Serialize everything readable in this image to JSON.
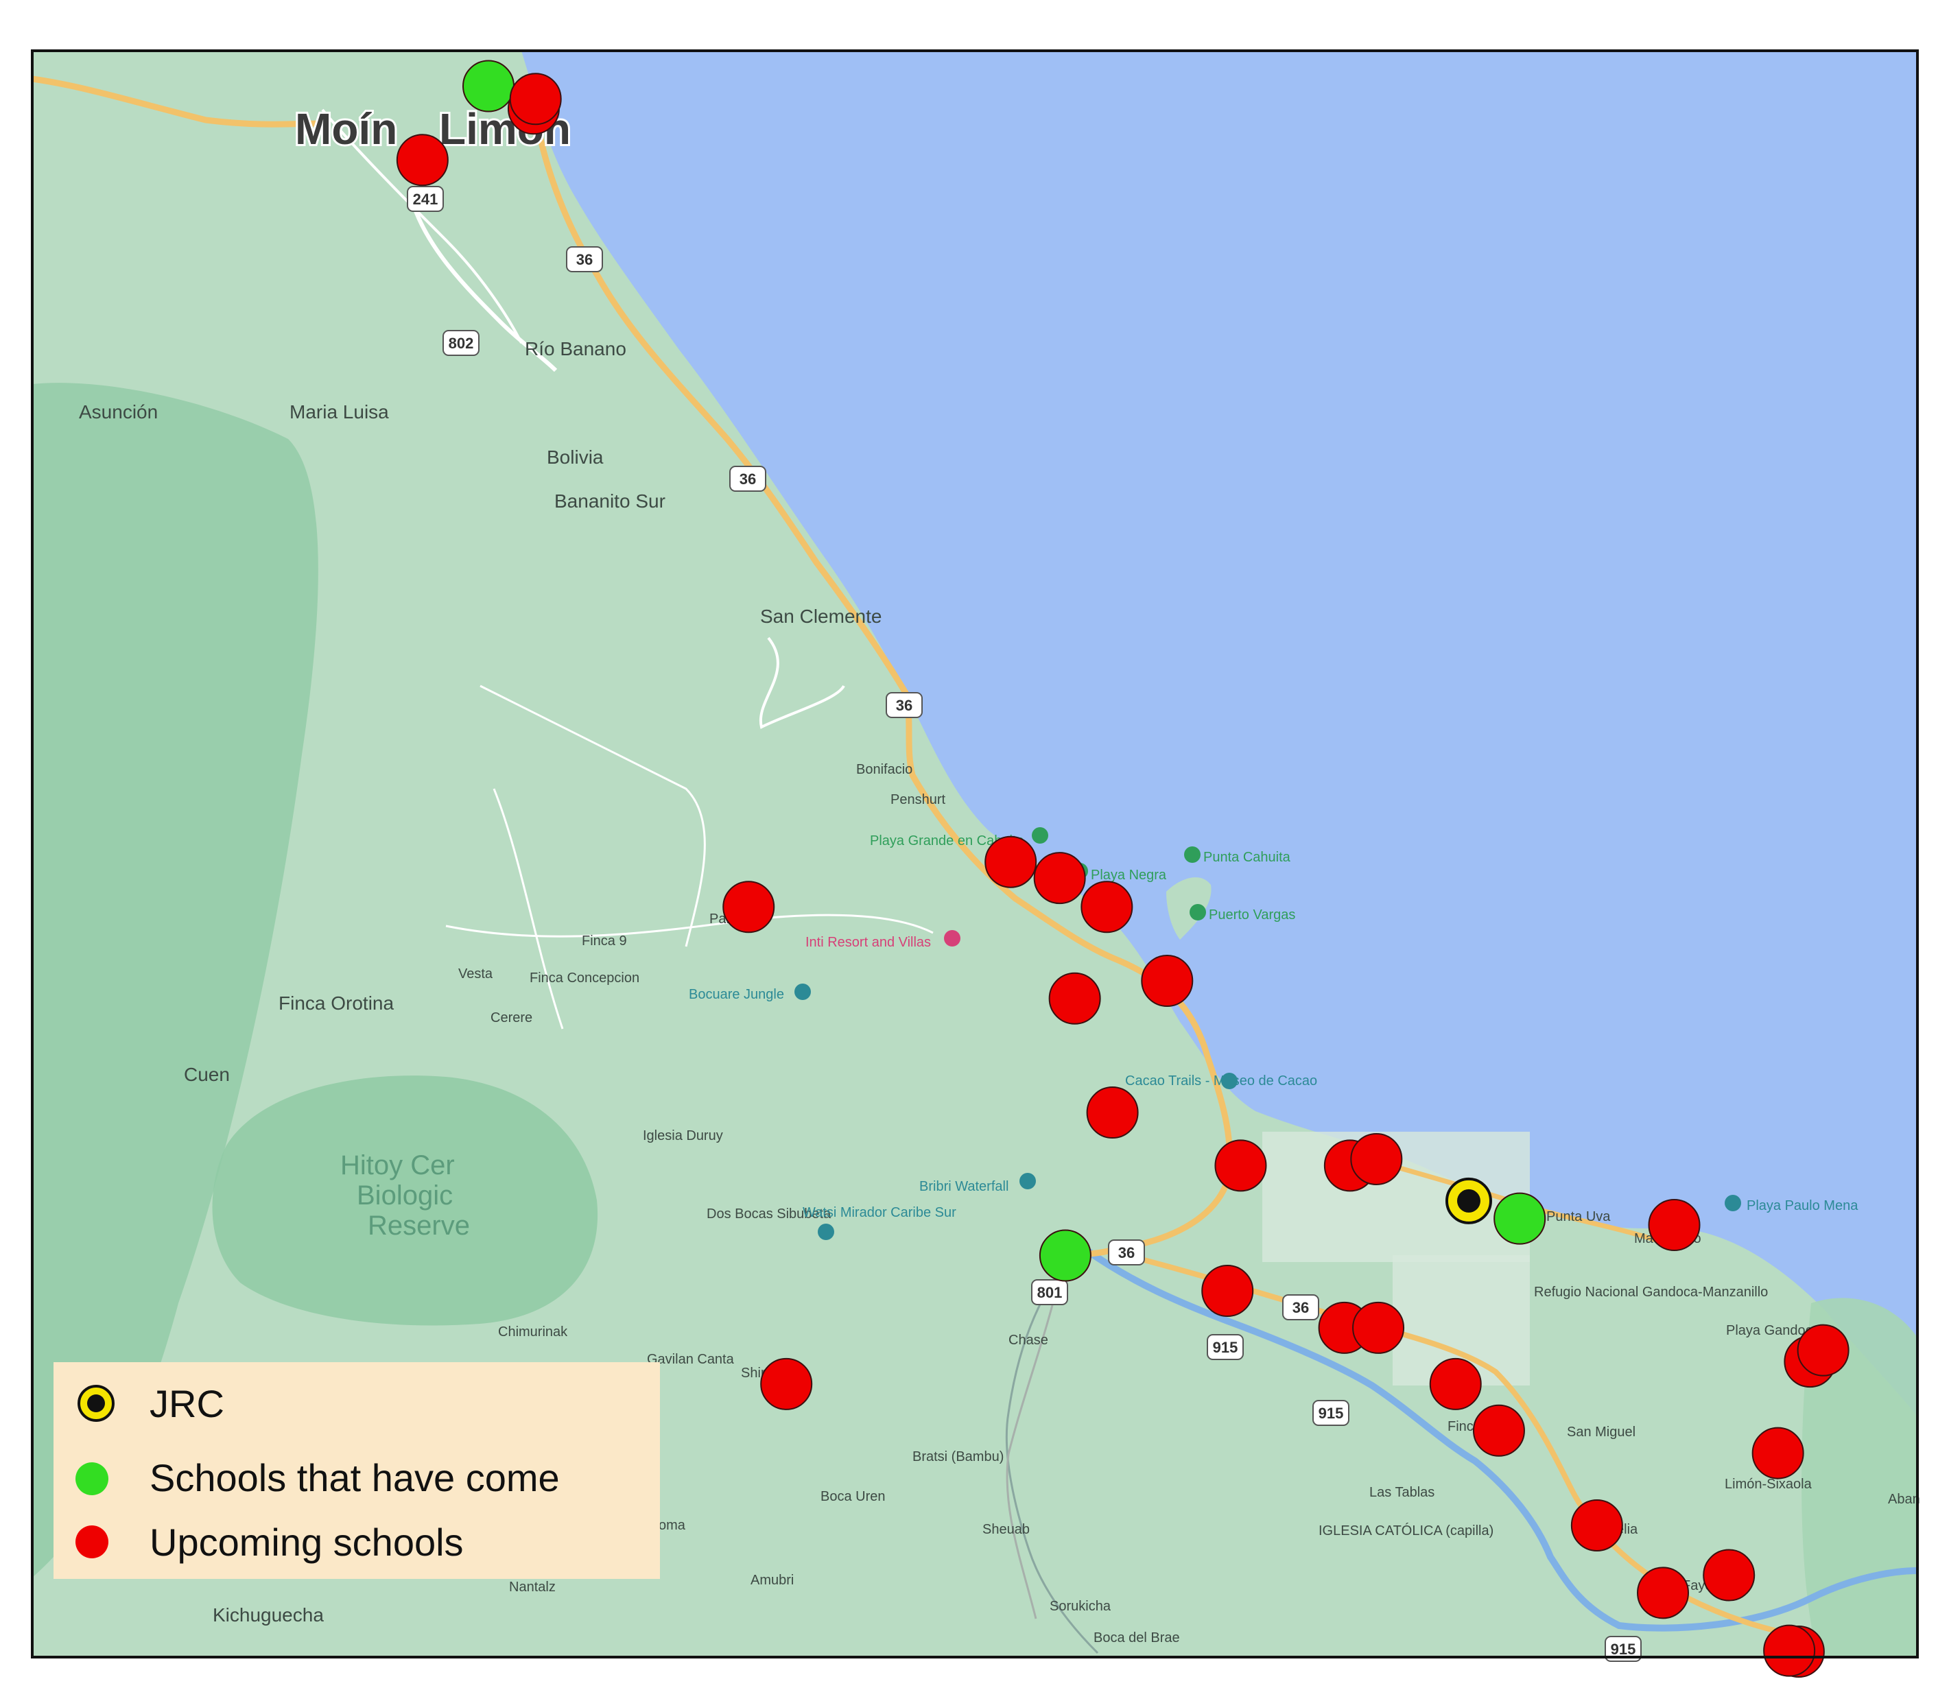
{
  "legend": {
    "items": [
      {
        "key": "jrc",
        "label": "JRC"
      },
      {
        "key": "came",
        "label": "Schools that have come"
      },
      {
        "key": "upcoming",
        "label": "Upcoming schools"
      }
    ]
  },
  "colors": {
    "sea": "#9fbff5",
    "land": "#b9dcc3",
    "forest": "#8fcaa4",
    "road": "#f2c26a",
    "river": "#7fb1e6",
    "jrc_fill": "#111111",
    "jrc_ring": "#f5e400",
    "came": "#33dd22",
    "upcoming": "#ee0000",
    "legend_bg": "#fbe8c8"
  },
  "cities": [
    {
      "id": "moin",
      "name": "Moín"
    },
    {
      "id": "limon",
      "name": "Limón"
    }
  ],
  "road_shields": [
    "241",
    "36",
    "802",
    "36",
    "36",
    "801",
    "36",
    "36",
    "915",
    "915",
    "915"
  ],
  "places": [
    {
      "name": "Río Banano"
    },
    {
      "name": "Asunción"
    },
    {
      "name": "Maria Luisa"
    },
    {
      "name": "Bolivia"
    },
    {
      "name": "Bananito Sur"
    },
    {
      "name": "San Clemente"
    },
    {
      "name": "Bonifacio"
    },
    {
      "name": "Penshurt"
    },
    {
      "name": "Finca 9"
    },
    {
      "name": "Vesta"
    },
    {
      "name": "Finca Concepcion"
    },
    {
      "name": "Cerere"
    },
    {
      "name": "Finca Orotina"
    },
    {
      "name": "Cuen"
    },
    {
      "name": "Iglesia Duruy"
    },
    {
      "name": "Dos Bocas Sibubeta"
    },
    {
      "name": "Chimurinak"
    },
    {
      "name": "Gavilan Canta"
    },
    {
      "name": "Chase"
    },
    {
      "name": "Bratsi (Bambu)"
    },
    {
      "name": "Boca Uren"
    },
    {
      "name": "Sheuab"
    },
    {
      "name": "Amubri"
    },
    {
      "name": "Nantalz"
    },
    {
      "name": "Kichuguecha"
    },
    {
      "name": "Sorukicha"
    },
    {
      "name": "Boca del Brae"
    },
    {
      "name": "Las Tablas"
    },
    {
      "name": "IGLESIA CATÓLICA (capilla)"
    },
    {
      "name": "San Miguel"
    },
    {
      "name": "Punta Uva"
    },
    {
      "name": "Refugio Nacional Gandoca-Manzanillo"
    },
    {
      "name": "Playa Gandoca"
    },
    {
      "name": "Limón-Sixaola"
    },
    {
      "name": "Fayonta"
    },
    {
      "name": "Finca"
    },
    {
      "name": "celia"
    },
    {
      "name": "Ma"
    },
    {
      "name": "lo"
    },
    {
      "name": "Par"
    },
    {
      "name": "Shir"
    },
    {
      "name": "oma"
    },
    {
      "name": "Aban"
    }
  ],
  "pois": [
    {
      "name": "Playa Grande en Cahuita",
      "kind": "green"
    },
    {
      "name": "Playa Negra",
      "kind": "green"
    },
    {
      "name": "Punta Cahuita",
      "kind": "green"
    },
    {
      "name": "Puerto Vargas",
      "kind": "green"
    },
    {
      "name": "Inti Resort and Villas",
      "kind": "pink"
    },
    {
      "name": "Bocuare Jungle",
      "kind": "teal"
    },
    {
      "name": "Cacao Trails - Museo de Cacao",
      "kind": "teal"
    },
    {
      "name": "Bribri Waterfall",
      "kind": "teal"
    },
    {
      "name": "Watsi Mirador Caribe Sur",
      "kind": "teal"
    },
    {
      "name": "Playa Paulo Mena",
      "kind": "teal"
    }
  ],
  "reserve_label": [
    "Hitoy Cer",
    "Biologic",
    "Reserve"
  ],
  "markers": [
    {
      "kind": "came",
      "lon_frac": 0.242,
      "lat_frac": 0.022
    },
    {
      "kind": "upcoming",
      "lon_frac": 0.266,
      "lat_frac": 0.036
    },
    {
      "kind": "upcoming",
      "lon_frac": 0.267,
      "lat_frac": 0.03
    },
    {
      "kind": "upcoming",
      "lon_frac": 0.207,
      "lat_frac": 0.068
    },
    {
      "kind": "upcoming",
      "lon_frac": 0.38,
      "lat_frac": 0.533
    },
    {
      "kind": "upcoming",
      "lon_frac": 0.519,
      "lat_frac": 0.505
    },
    {
      "kind": "upcoming",
      "lon_frac": 0.545,
      "lat_frac": 0.515
    },
    {
      "kind": "upcoming",
      "lon_frac": 0.57,
      "lat_frac": 0.533
    },
    {
      "kind": "upcoming",
      "lon_frac": 0.602,
      "lat_frac": 0.579
    },
    {
      "kind": "upcoming",
      "lon_frac": 0.553,
      "lat_frac": 0.59
    },
    {
      "kind": "upcoming",
      "lon_frac": 0.573,
      "lat_frac": 0.661
    },
    {
      "kind": "upcoming",
      "lon_frac": 0.641,
      "lat_frac": 0.694
    },
    {
      "kind": "upcoming",
      "lon_frac": 0.699,
      "lat_frac": 0.694
    },
    {
      "kind": "upcoming",
      "lon_frac": 0.713,
      "lat_frac": 0.69
    },
    {
      "kind": "jrc",
      "lon_frac": 0.762,
      "lat_frac": 0.716
    },
    {
      "kind": "came",
      "lon_frac": 0.789,
      "lat_frac": 0.727
    },
    {
      "kind": "upcoming",
      "lon_frac": 0.871,
      "lat_frac": 0.731
    },
    {
      "kind": "came",
      "lon_frac": 0.548,
      "lat_frac": 0.75
    },
    {
      "kind": "upcoming",
      "lon_frac": 0.634,
      "lat_frac": 0.772
    },
    {
      "kind": "upcoming",
      "lon_frac": 0.696,
      "lat_frac": 0.795
    },
    {
      "kind": "upcoming",
      "lon_frac": 0.714,
      "lat_frac": 0.795
    },
    {
      "kind": "upcoming",
      "lon_frac": 0.755,
      "lat_frac": 0.83
    },
    {
      "kind": "upcoming",
      "lon_frac": 0.778,
      "lat_frac": 0.859
    },
    {
      "kind": "upcoming",
      "lon_frac": 0.4,
      "lat_frac": 0.83
    },
    {
      "kind": "upcoming",
      "lon_frac": 0.943,
      "lat_frac": 0.816
    },
    {
      "kind": "upcoming",
      "lon_frac": 0.95,
      "lat_frac": 0.809
    },
    {
      "kind": "upcoming",
      "lon_frac": 0.926,
      "lat_frac": 0.873
    },
    {
      "kind": "upcoming",
      "lon_frac": 0.83,
      "lat_frac": 0.918
    },
    {
      "kind": "upcoming",
      "lon_frac": 0.865,
      "lat_frac": 0.96
    },
    {
      "kind": "upcoming",
      "lon_frac": 0.9,
      "lat_frac": 0.949
    },
    {
      "kind": "upcoming",
      "lon_frac": 0.937,
      "lat_frac": 1.005
    },
    {
      "kind": "upcoming",
      "lon_frac": 0.932,
      "lat_frac": 0.996
    }
  ]
}
